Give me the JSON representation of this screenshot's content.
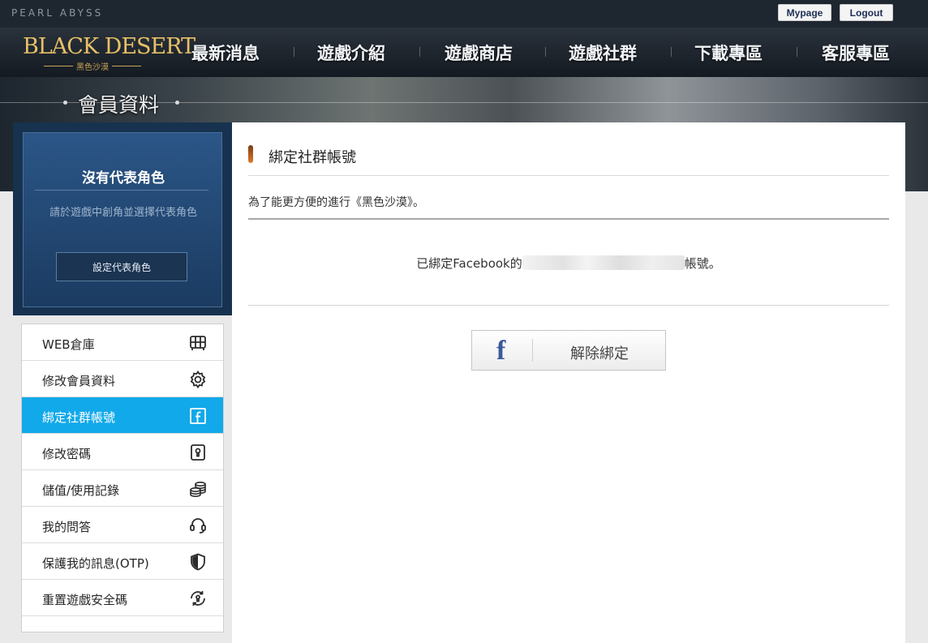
{
  "topbar": {
    "brand": "PEARL ABYSS",
    "mypage_label": "Mypage",
    "logout_label": "Logout"
  },
  "logo": {
    "main": "BLACK DESERT",
    "sub": "黑色沙漠"
  },
  "nav": {
    "items": [
      "最新消息",
      "遊戲介紹",
      "遊戲商店",
      "遊戲社群",
      "下載專區",
      "客服專區"
    ]
  },
  "hero": {
    "title": "會員資料"
  },
  "profile": {
    "title": "沒有代表角色",
    "subtitle": "請於遊戲中創角並選擇代表角色",
    "button_label": "設定代表角色"
  },
  "menu": {
    "items": [
      {
        "label": "WEB倉庫",
        "icon": "warehouse-icon"
      },
      {
        "label": "修改會員資料",
        "icon": "gear-icon"
      },
      {
        "label": "綁定社群帳號",
        "icon": "facebook-icon",
        "active": true
      },
      {
        "label": "修改密碼",
        "icon": "keyhole-icon"
      },
      {
        "label": "儲值/使用記錄",
        "icon": "coins-icon"
      },
      {
        "label": "我的問答",
        "icon": "headset-icon"
      },
      {
        "label": "保護我的訊息(OTP)",
        "icon": "shield-icon"
      },
      {
        "label": "重置遊戲安全碼",
        "icon": "reset-lock-icon"
      }
    ]
  },
  "content": {
    "section_title": "綁定社群帳號",
    "intro": "為了能更方便的進行《黑色沙漠》。",
    "bound_prefix": "已綁定Facebook的",
    "bound_suffix": "帳號。",
    "unbind_label": "解除綁定",
    "fb_glyph": "f"
  },
  "colors": {
    "active_menu": "#11a9ea",
    "profile_bg": "#1b3b61",
    "logo_gold": "#e7c067",
    "facebook_blue": "#3b5a9a"
  }
}
